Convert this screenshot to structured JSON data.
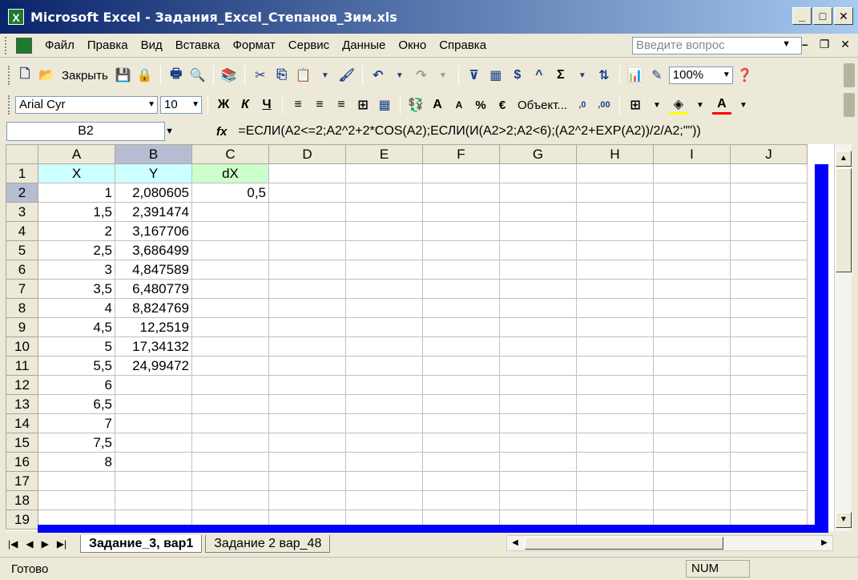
{
  "window": {
    "title": "Microsoft Excel - Задания_Excel_Степанов_Зим.xls",
    "min": "_",
    "max": "□",
    "close": "✕"
  },
  "menu": {
    "items": [
      "Файл",
      "Правка",
      "Вид",
      "Вставка",
      "Формат",
      "Сервис",
      "Данные",
      "Окно",
      "Справка"
    ],
    "help_placeholder": "Введите вопрос",
    "doc_min": "–",
    "doc_restore": "❐",
    "doc_close": "✕"
  },
  "toolbar1": {
    "close_label": "Закрыть",
    "zoom": "100%"
  },
  "toolbar2": {
    "font": "Arial Cyr",
    "size": "10",
    "bold": "Ж",
    "italic": "К",
    "underline": "Ч",
    "percent": "%",
    "euro": "€",
    "object_label": "Объект..."
  },
  "formula_bar": {
    "name_box": "B2",
    "fx": "fx",
    "formula": "=ЕСЛИ(A2<=2;A2^2+2*COS(A2);ЕСЛИ(И(A2>2;A2<6);(A2^2+EXP(A2))/2/A2;\"\"))"
  },
  "columns": [
    "A",
    "B",
    "C",
    "D",
    "E",
    "F",
    "G",
    "H",
    "I",
    "J"
  ],
  "rows": [
    {
      "n": "1",
      "a": "X",
      "b": "Y",
      "c": "dX"
    },
    {
      "n": "2",
      "a": "1",
      "b": "2,080605",
      "c": "0,5"
    },
    {
      "n": "3",
      "a": "1,5",
      "b": "2,391474",
      "c": ""
    },
    {
      "n": "4",
      "a": "2",
      "b": "3,167706",
      "c": ""
    },
    {
      "n": "5",
      "a": "2,5",
      "b": "3,686499",
      "c": ""
    },
    {
      "n": "6",
      "a": "3",
      "b": "4,847589",
      "c": ""
    },
    {
      "n": "7",
      "a": "3,5",
      "b": "6,480779",
      "c": ""
    },
    {
      "n": "8",
      "a": "4",
      "b": "8,824769",
      "c": ""
    },
    {
      "n": "9",
      "a": "4,5",
      "b": "12,2519",
      "c": ""
    },
    {
      "n": "10",
      "a": "5",
      "b": "17,34132",
      "c": ""
    },
    {
      "n": "11",
      "a": "5,5",
      "b": "24,99472",
      "c": ""
    },
    {
      "n": "12",
      "a": "6",
      "b": "",
      "c": ""
    },
    {
      "n": "13",
      "a": "6,5",
      "b": "",
      "c": ""
    },
    {
      "n": "14",
      "a": "7",
      "b": "",
      "c": ""
    },
    {
      "n": "15",
      "a": "7,5",
      "b": "",
      "c": ""
    },
    {
      "n": "16",
      "a": "8",
      "b": "",
      "c": ""
    },
    {
      "n": "17",
      "a": "",
      "b": "",
      "c": ""
    },
    {
      "n": "18",
      "a": "",
      "b": "",
      "c": ""
    },
    {
      "n": "19",
      "a": "",
      "b": "",
      "c": ""
    }
  ],
  "sheet_tabs": [
    "Задание_3, вар1",
    "Задание 2 вар_48"
  ],
  "status": {
    "text": "Готово",
    "num": "NUM"
  },
  "colors": {
    "header_cyan": "#ccffff",
    "header_green": "#ccffcc",
    "print_area_blue": "#0000ff"
  }
}
